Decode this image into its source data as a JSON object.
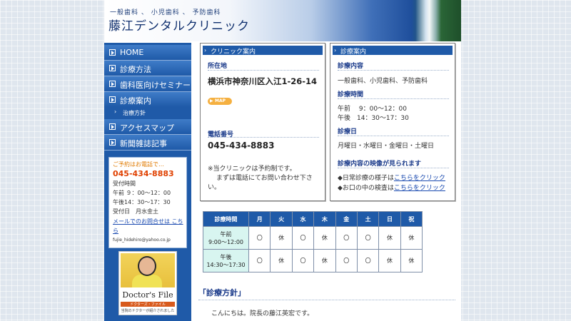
{
  "header": {
    "tagline": "一般歯科 、 小児歯科 、 予防歯科",
    "title": "藤江デンタルクリニック"
  },
  "sidebar": {
    "items": [
      {
        "label": "HOME"
      },
      {
        "label": "診療方法"
      },
      {
        "label": "歯科医向けセミナー"
      },
      {
        "label": "診療案内"
      },
      {
        "label": "アクセスマップ"
      },
      {
        "label": "新聞雑誌記事"
      }
    ],
    "subitem": {
      "label": "治療方針"
    }
  },
  "contact": {
    "heading": "ご予約はお電話で…",
    "phone": "045-434-8883",
    "hours_label": "受付時間",
    "am": "午前 ９：00～12：00",
    "pm": "午後14：30～17：30",
    "days": "受付日　月水金土",
    "mail_link": "メールでのお問合せは こちら",
    "email": "fujie_hidehiro@yahoo.co.jp"
  },
  "doctors_file": {
    "title": "Doctor's File",
    "subtitle": "当院のドクターが紹介されました",
    "bar_text": "ドクターズ・ファイル"
  },
  "clinic_box": {
    "title": "クリニック案内",
    "address_label": "所在地",
    "address": "横浜市神奈川区入江1-26-14",
    "map_label": "MAP",
    "phone_label": "電話番号",
    "phone": "045-434-8883",
    "note_1": "※当クリニックは予約制です。",
    "note_2": "まずは電話にてお問い合わせ下さ",
    "note_3": "い。"
  },
  "shinryo_box": {
    "title": "診療案内",
    "content_label": "診療内容",
    "content": "一般歯科、小児歯科、予防歯科",
    "time_label": "診療時間",
    "am": "午前　 9：00～12：00",
    "pm": "午後　14：30～17：30",
    "day_label": "診療日",
    "days": "月曜日・水曜日・金曜日・土曜日",
    "video_label": "診療内容の映像が見られます",
    "video_1_prefix": "◆日常診療の様子は",
    "video_1_link": "こちらをクリック",
    "video_2_prefix": "◆お口の中の検査は",
    "video_2_link": "こちらをクリック"
  },
  "schedule": {
    "headers": [
      "診療時間",
      "月",
      "火",
      "水",
      "木",
      "金",
      "土",
      "日",
      "祝"
    ],
    "rows": [
      {
        "time_1": "午前",
        "time_2": "9:00～12:00",
        "cells": [
          "〇",
          "休",
          "〇",
          "休",
          "〇",
          "〇",
          "休",
          "休"
        ]
      },
      {
        "time_1": "午後",
        "time_2": "14:30～17:30",
        "cells": [
          "〇",
          "休",
          "〇",
          "休",
          "〇",
          "〇",
          "休",
          "休"
        ]
      }
    ]
  },
  "policy": {
    "title": "「診療方針」",
    "greeting": "こんにちは。院長の藤江英宏です。"
  }
}
